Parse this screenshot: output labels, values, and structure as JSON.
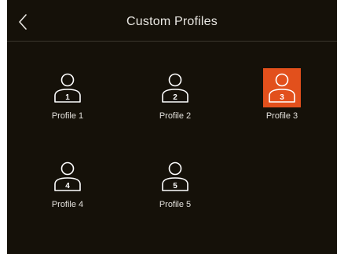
{
  "header": {
    "title": "Custom Profiles"
  },
  "icons": {
    "back": "chevron-left-icon",
    "profile": "person-icon"
  },
  "profiles": [
    {
      "number": "1",
      "label": "Profile 1",
      "selected": false
    },
    {
      "number": "2",
      "label": "Profile 2",
      "selected": false
    },
    {
      "number": "3",
      "label": "Profile 3",
      "selected": true
    },
    {
      "number": "4",
      "label": "Profile 4",
      "selected": false
    },
    {
      "number": "5",
      "label": "Profile 5",
      "selected": false
    }
  ],
  "colors": {
    "background": "#151109",
    "selected": "#e2501c",
    "text": "#e9e7e2"
  }
}
